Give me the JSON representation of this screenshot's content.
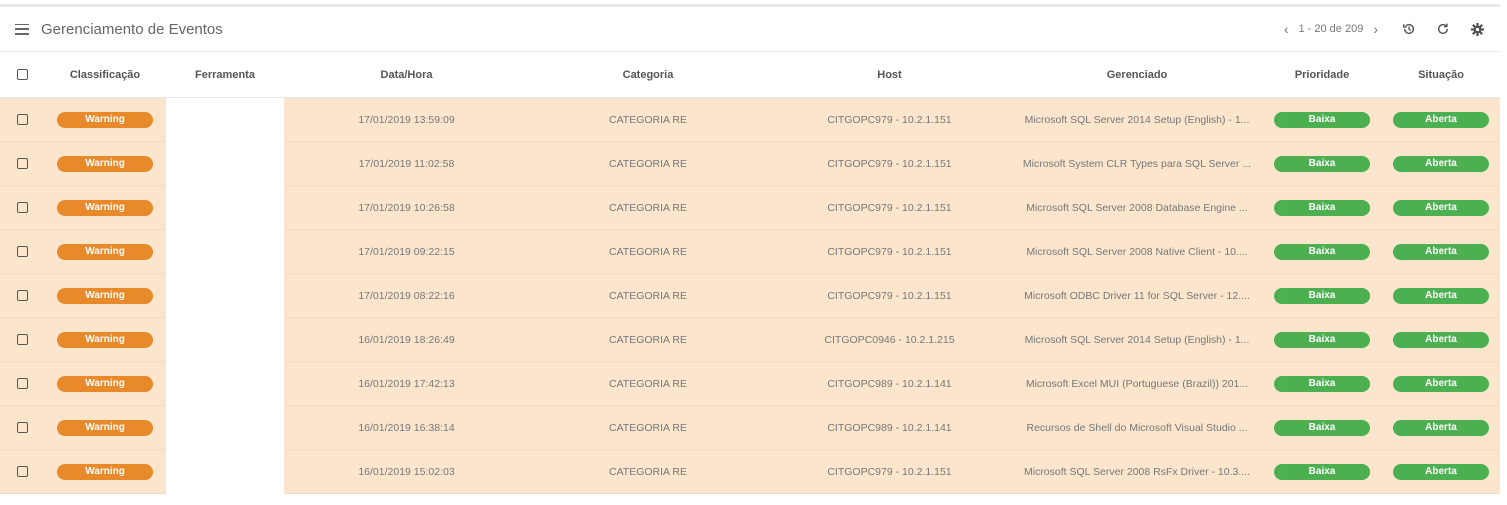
{
  "header": {
    "title": "Gerenciamento de Eventos",
    "pagination": "1 - 20 de 209",
    "icons": [
      "menu-icon",
      "chevron-left-icon",
      "chevron-right-icon",
      "history-icon",
      "refresh-icon",
      "gear-icon"
    ]
  },
  "columns": [
    "Classificação",
    "Ferramenta",
    "Data/Hora",
    "Categoria",
    "Host",
    "Gerenciado",
    "Prioridade",
    "Situação"
  ],
  "colors": {
    "warning": "#e8892a",
    "ok": "#4caf50",
    "row_bg": "#fbe6cd"
  },
  "rows": [
    {
      "classificacao": "Warning",
      "ferramenta": "",
      "data_hora": "17/01/2019 13:59:09",
      "categoria": "CATEGORIA RE",
      "host": "CITGOPC979 - 10.2.1.151",
      "gerenciado": "Microsoft SQL Server 2014 Setup (English) - 1...",
      "prioridade": "Baixa",
      "situacao": "Aberta"
    },
    {
      "classificacao": "Warning",
      "ferramenta": "",
      "data_hora": "17/01/2019 11:02:58",
      "categoria": "CATEGORIA RE",
      "host": "CITGOPC979 - 10.2.1.151",
      "gerenciado": "Microsoft System CLR Types para SQL Server ...",
      "prioridade": "Baixa",
      "situacao": "Aberta"
    },
    {
      "classificacao": "Warning",
      "ferramenta": "",
      "data_hora": "17/01/2019 10:26:58",
      "categoria": "CATEGORIA RE",
      "host": "CITGOPC979 - 10.2.1.151",
      "gerenciado": "Microsoft SQL Server 2008 Database Engine ...",
      "prioridade": "Baixa",
      "situacao": "Aberta"
    },
    {
      "classificacao": "Warning",
      "ferramenta": "",
      "data_hora": "17/01/2019 09:22:15",
      "categoria": "CATEGORIA RE",
      "host": "CITGOPC979 - 10.2.1.151",
      "gerenciado": "Microsoft SQL Server 2008 Native Client - 10....",
      "prioridade": "Baixa",
      "situacao": "Aberta"
    },
    {
      "classificacao": "Warning",
      "ferramenta": "",
      "data_hora": "17/01/2019 08:22:16",
      "categoria": "CATEGORIA RE",
      "host": "CITGOPC979 - 10.2.1.151",
      "gerenciado": "Microsoft ODBC Driver 11 for SQL Server - 12....",
      "prioridade": "Baixa",
      "situacao": "Aberta"
    },
    {
      "classificacao": "Warning",
      "ferramenta": "",
      "data_hora": "16/01/2019 18:26:49",
      "categoria": "CATEGORIA RE",
      "host": "CITGOPC0946 - 10.2.1.215",
      "gerenciado": "Microsoft SQL Server 2014 Setup (English) - 1...",
      "prioridade": "Baixa",
      "situacao": "Aberta"
    },
    {
      "classificacao": "Warning",
      "ferramenta": "",
      "data_hora": "16/01/2019 17:42:13",
      "categoria": "CATEGORIA RE",
      "host": "CITGOPC989 - 10.2.1.141",
      "gerenciado": "Microsoft Excel MUI (Portuguese (Brazil)) 201...",
      "prioridade": "Baixa",
      "situacao": "Aberta"
    },
    {
      "classificacao": "Warning",
      "ferramenta": "",
      "data_hora": "16/01/2019 16:38:14",
      "categoria": "CATEGORIA RE",
      "host": "CITGOPC989 - 10.2.1.141",
      "gerenciado": "Recursos de Shell do Microsoft Visual Studio ...",
      "prioridade": "Baixa",
      "situacao": "Aberta"
    },
    {
      "classificacao": "Warning",
      "ferramenta": "",
      "data_hora": "16/01/2019 15:02:03",
      "categoria": "CATEGORIA RE",
      "host": "CITGOPC979 - 10.2.1.151",
      "gerenciado": "Microsoft SQL Server 2008 RsFx Driver - 10.3....",
      "prioridade": "Baixa",
      "situacao": "Aberta"
    }
  ]
}
